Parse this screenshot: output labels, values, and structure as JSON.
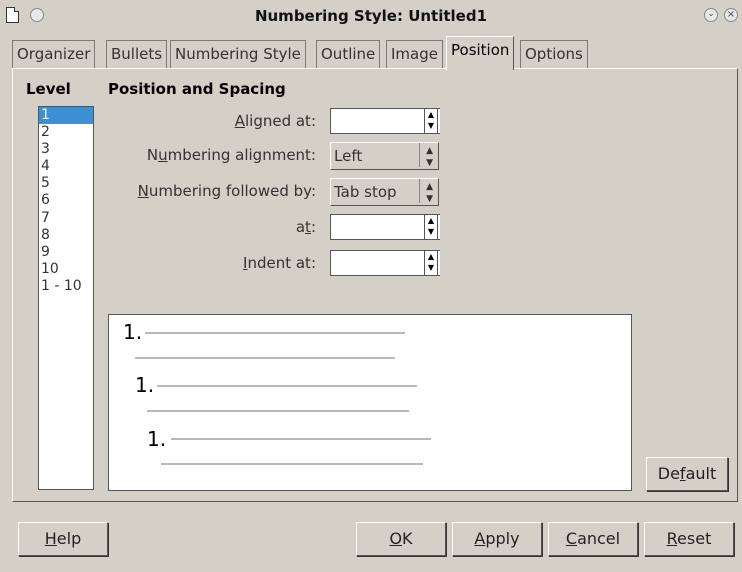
{
  "window": {
    "title": "Numbering Style: Untitled1"
  },
  "tabs": [
    {
      "label": "Organizer",
      "active": false
    },
    {
      "label": "Bullets",
      "active": false
    },
    {
      "label": "Numbering Style",
      "active": false
    },
    {
      "label": "Outline",
      "active": false
    },
    {
      "label": "Image",
      "active": false
    },
    {
      "label": "Position",
      "active": true
    },
    {
      "label": "Options",
      "active": false
    }
  ],
  "level": {
    "heading": "Level",
    "items": [
      "1",
      "2",
      "3",
      "4",
      "5",
      "6",
      "7",
      "8",
      "9",
      "10",
      "1 - 10"
    ],
    "selected": "1"
  },
  "position": {
    "heading": "Position and Spacing",
    "aligned_at": {
      "label_pre": "",
      "label_u": "A",
      "label_post": "ligned at:",
      "value": ""
    },
    "numbering_alignment": {
      "label_pre": "N",
      "label_u": "u",
      "label_post": "mbering alignment:",
      "value": "Left"
    },
    "followed_by": {
      "label_pre": "",
      "label_u": "N",
      "label_post": "umbering followed by:",
      "value": "Tab stop"
    },
    "at": {
      "label_pre": "a",
      "label_u": "t",
      "label_post": ":",
      "value": ""
    },
    "indent_at": {
      "label_pre": "",
      "label_u": "I",
      "label_post": "ndent at:",
      "value": ""
    }
  },
  "preview": {
    "numbers": [
      "1.",
      "1.",
      "1."
    ]
  },
  "buttons": {
    "default": {
      "pre": "De",
      "u": "f",
      "post": "ault"
    },
    "help": {
      "pre": "",
      "u": "H",
      "post": "elp"
    },
    "ok": {
      "pre": "",
      "u": "O",
      "post": "K"
    },
    "apply": {
      "pre": "",
      "u": "A",
      "post": "pply"
    },
    "cancel": {
      "pre": "",
      "u": "C",
      "post": "ancel"
    },
    "reset": {
      "pre": "",
      "u": "R",
      "post": "eset"
    }
  }
}
